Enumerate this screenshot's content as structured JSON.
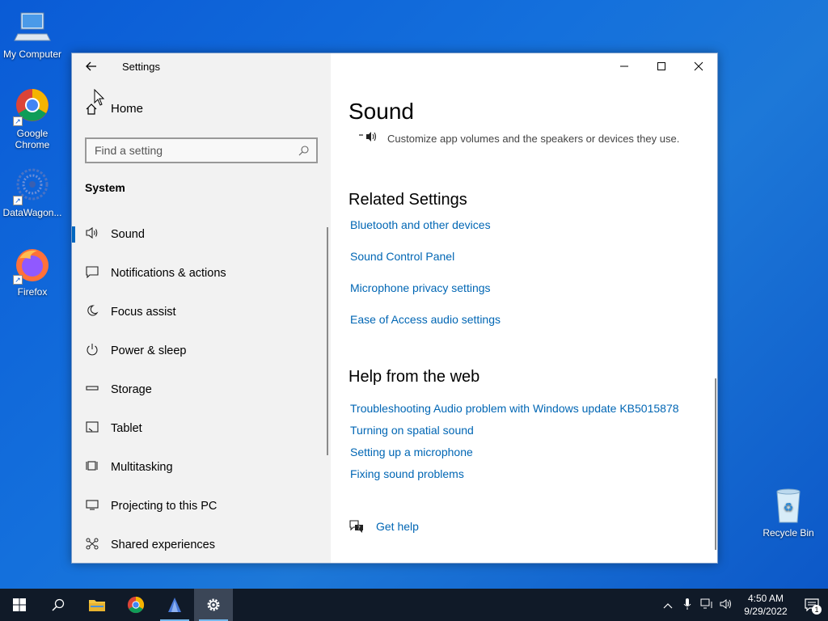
{
  "desktop": {
    "icons": [
      {
        "label": "My Computer"
      },
      {
        "label": "Google Chrome"
      },
      {
        "label": "DataWagon..."
      },
      {
        "label": "Firefox"
      },
      {
        "label": "Recycle Bin"
      }
    ]
  },
  "window": {
    "app_title": "Settings",
    "home_label": "Home",
    "search_placeholder": "Find a setting",
    "section_heading": "System",
    "nav": [
      {
        "label": "Sound",
        "icon": "speaker-icon",
        "active": true
      },
      {
        "label": "Notifications & actions",
        "icon": "notification-icon"
      },
      {
        "label": "Focus assist",
        "icon": "moon-icon"
      },
      {
        "label": "Power & sleep",
        "icon": "power-icon"
      },
      {
        "label": "Storage",
        "icon": "storage-icon"
      },
      {
        "label": "Tablet",
        "icon": "tablet-icon"
      },
      {
        "label": "Multitasking",
        "icon": "multitasking-icon"
      },
      {
        "label": "Projecting to this PC",
        "icon": "projector-icon"
      },
      {
        "label": "Shared experiences",
        "icon": "shared-icon"
      }
    ]
  },
  "main": {
    "page_title": "Sound",
    "app_volume_description": "Customize app volumes and the speakers or devices they use.",
    "related_heading": "Related Settings",
    "related_links": [
      "Bluetooth and other devices",
      "Sound Control Panel",
      "Microphone privacy settings",
      "Ease of Access audio settings"
    ],
    "web_heading": "Help from the web",
    "web_links": [
      "Troubleshooting Audio problem with Windows update KB5015878",
      "Turning on spatial sound",
      "Setting up a microphone",
      "Fixing sound problems"
    ],
    "get_help": "Get help"
  },
  "taskbar": {
    "clock_time": "4:50 AM",
    "clock_date": "9/29/2022",
    "notification_count": "1"
  },
  "colors": {
    "accent": "#0067c0",
    "link": "#0066b4",
    "desktop": "#1470dc",
    "taskbar": "#101a28"
  }
}
